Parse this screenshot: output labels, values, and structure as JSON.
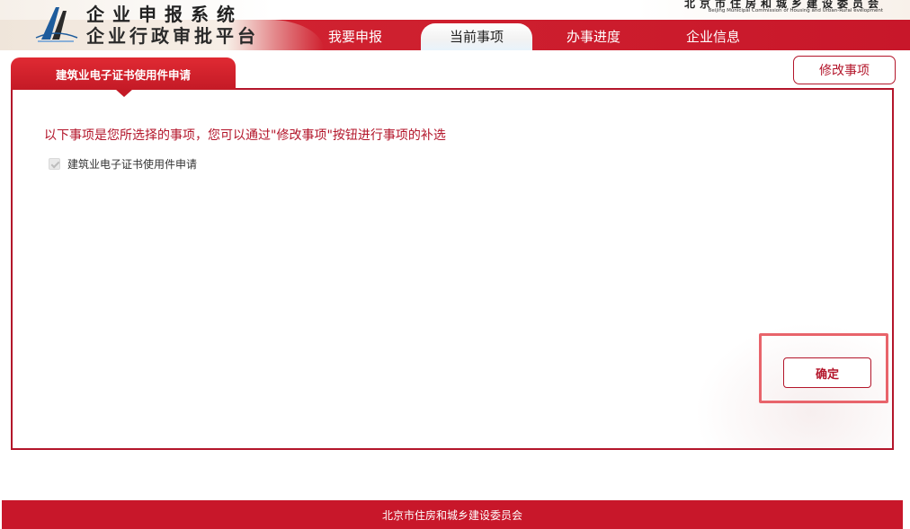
{
  "header": {
    "system_title": "企业申报系统",
    "system_subtitle": "企业行政审批平台",
    "org_name_cn": "北京市住房和城乡建设委员会",
    "org_name_en": "Beijing Municipal Commission of Housing and Urban-Rural evelopment",
    "brand_color": "#c8172a"
  },
  "nav": {
    "tabs": [
      {
        "label": "我要申报",
        "active": false
      },
      {
        "label": "当前事项",
        "active": true
      },
      {
        "label": "办事进度",
        "active": false
      },
      {
        "label": "企业信息",
        "active": false
      }
    ]
  },
  "content": {
    "tab_label": "建筑业电子证书使用件申请",
    "modify_button": "修改事项",
    "notice": "以下事项是您所选择的事项，您可以通过\"修改事项\"按钮进行事项的补选",
    "items": [
      {
        "label": "建筑业电子证书使用件申请",
        "checked": true,
        "disabled": true
      }
    ],
    "confirm_button": "确定"
  },
  "footer": {
    "text": "北京市住房和城乡建设委员会"
  }
}
